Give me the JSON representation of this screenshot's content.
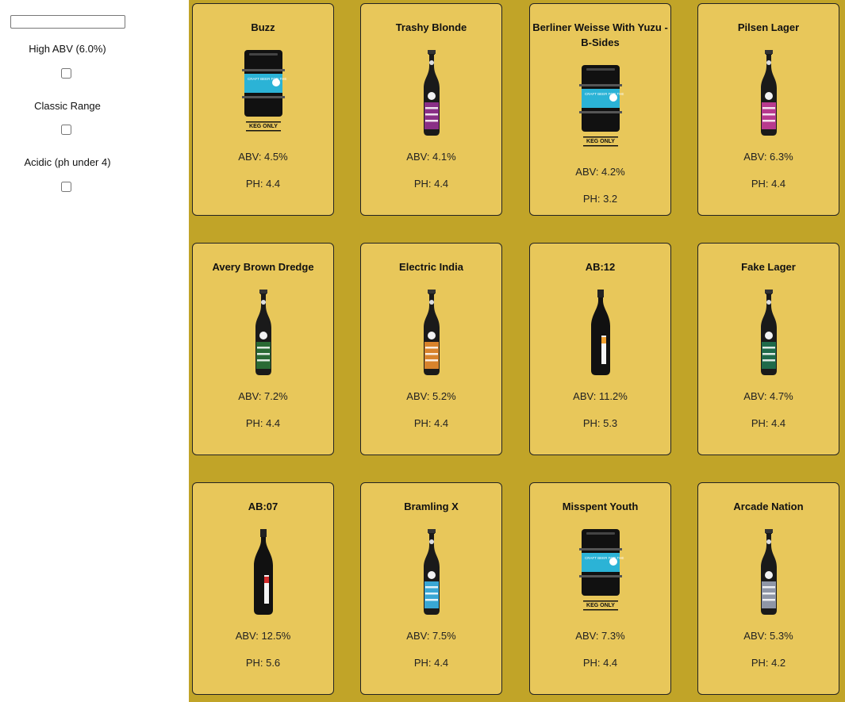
{
  "search": {
    "placeholder": "",
    "value": ""
  },
  "filters": [
    {
      "label": "High ABV (6.0%)",
      "checked": false
    },
    {
      "label": "Classic Range",
      "checked": false
    },
    {
      "label": "Acidic (ph under 4)",
      "checked": false
    }
  ],
  "beers": [
    {
      "name": "Buzz",
      "abv": "ABV: 4.5%",
      "ph": "PH: 4.4",
      "image": "keg-icon",
      "label_color": "#2bb3d6",
      "keg_text": "KEG ONLY",
      "keg_label": "CRAFT BEER FOR THE PEOPLE"
    },
    {
      "name": "Trashy Blonde",
      "abv": "ABV: 4.1%",
      "ph": "PH: 4.4",
      "image": "bottle-icon",
      "label_color": "#8a2f86"
    },
    {
      "name": "Berliner Weisse With Yuzu - B-Sides",
      "abv": "ABV: 4.2%",
      "ph": "PH: 3.2",
      "image": "keg-icon",
      "label_color": "#2bb3d6",
      "keg_text": "KEG ONLY",
      "keg_label": "CRAFT BEER FOR THE PEOPLE"
    },
    {
      "name": "Pilsen Lager",
      "abv": "ABV: 6.3%",
      "ph": "PH: 4.4",
      "image": "bottle-icon",
      "label_color": "#b83a8e"
    },
    {
      "name": "Avery Brown Dredge",
      "abv": "ABV: 7.2%",
      "ph": "PH: 4.4",
      "image": "bottle-icon",
      "label_color": "#2a6a34"
    },
    {
      "name": "Electric India",
      "abv": "ABV: 5.2%",
      "ph": "PH: 4.4",
      "image": "bottle-icon",
      "label_color": "#d8832c"
    },
    {
      "name": "AB:12",
      "abv": "ABV: 11.2%",
      "ph": "PH: 5.3",
      "image": "champagne-bottle-icon",
      "label_color": "#f0a030"
    },
    {
      "name": "Fake Lager",
      "abv": "ABV: 4.7%",
      "ph": "PH: 4.4",
      "image": "bottle-icon",
      "label_color": "#1f6a4a"
    },
    {
      "name": "AB:07",
      "abv": "ABV: 12.5%",
      "ph": "PH: 5.6",
      "image": "champagne-bottle-icon",
      "label_color": "#d02a2a"
    },
    {
      "name": "Bramling X",
      "abv": "ABV: 7.5%",
      "ph": "PH: 4.4",
      "image": "bottle-icon",
      "label_color": "#39a7d4"
    },
    {
      "name": "Misspent Youth",
      "abv": "ABV: 7.3%",
      "ph": "PH: 4.4",
      "image": "keg-icon",
      "label_color": "#2bb3d6",
      "keg_text": "KEG ONLY",
      "keg_label": "CRAFT BEER FOR THE PEOPLE"
    },
    {
      "name": "Arcade Nation",
      "abv": "ABV: 5.3%",
      "ph": "PH: 4.2",
      "image": "bottle-icon",
      "label_color": "#8f96a6"
    }
  ]
}
